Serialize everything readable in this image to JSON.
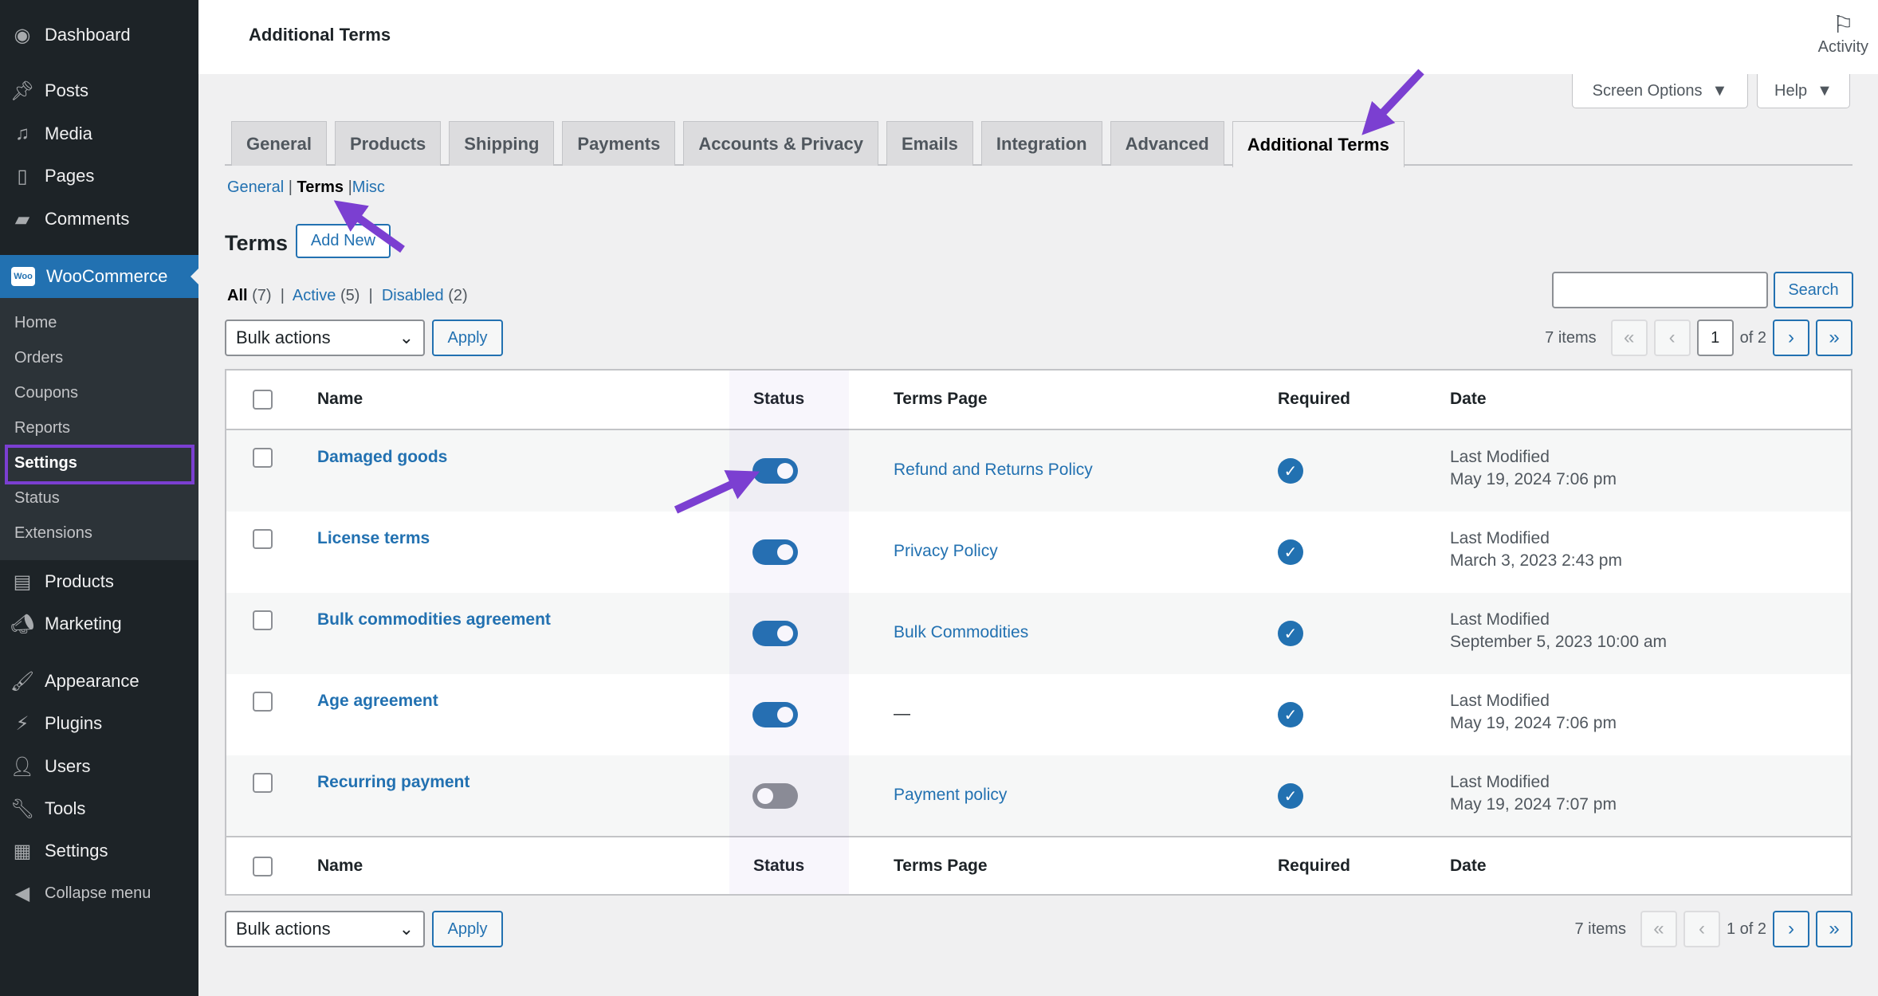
{
  "sidebar": {
    "dashboard": "Dashboard",
    "posts": "Posts",
    "media": "Media",
    "pages": "Pages",
    "comments": "Comments",
    "woocommerce": "WooCommerce",
    "woo_logo": "Woo",
    "sub": [
      "Home",
      "Orders",
      "Coupons",
      "Reports",
      "Settings",
      "Status",
      "Extensions"
    ],
    "products": "Products",
    "marketing": "Marketing",
    "appearance": "Appearance",
    "plugins": "Plugins",
    "users": "Users",
    "tools": "Tools",
    "settings": "Settings",
    "collapse": "Collapse menu"
  },
  "header": {
    "title": "Additional Terms",
    "activity": "Activity",
    "screen_options": "Screen Options",
    "help": "Help"
  },
  "tabs": [
    "General",
    "Products",
    "Shipping",
    "Payments",
    "Accounts & Privacy",
    "Emails",
    "Integration",
    "Advanced",
    "Additional Terms"
  ],
  "subtabs": {
    "general": "General",
    "terms": "Terms",
    "misc": "Misc"
  },
  "page": {
    "heading": "Terms",
    "add_new": "Add New"
  },
  "filters": {
    "all": "All",
    "all_count": "(7)",
    "active": "Active",
    "active_count": "(5)",
    "disabled": "Disabled",
    "disabled_count": "(2)"
  },
  "search": {
    "value": "",
    "button": "Search"
  },
  "bulk": {
    "selected": "Bulk actions",
    "apply": "Apply"
  },
  "pagination": {
    "items": "7 items",
    "first": "«",
    "prev": "‹",
    "current": "1",
    "of": "of 2",
    "of_bottom": "1 of 2",
    "next": "›",
    "last": "»"
  },
  "table": {
    "headers": {
      "name": "Name",
      "status": "Status",
      "terms_page": "Terms Page",
      "required": "Required",
      "date": "Date"
    },
    "rows": [
      {
        "name": "Damaged goods",
        "active": true,
        "terms_page": "Refund and Returns Policy",
        "required": true,
        "date_label": "Last Modified",
        "date": "May 19, 2024 7:06 pm"
      },
      {
        "name": "License terms",
        "active": true,
        "terms_page": "Privacy Policy",
        "required": true,
        "date_label": "Last Modified",
        "date": "March 3, 2023 2:43 pm"
      },
      {
        "name": "Bulk commodities agreement",
        "active": true,
        "terms_page": "Bulk Commodities",
        "required": true,
        "date_label": "Last Modified",
        "date": "September 5, 2023 10:00 am"
      },
      {
        "name": "Age agreement",
        "active": true,
        "terms_page": "—",
        "required": true,
        "date_label": "Last Modified",
        "date": "May 19, 2024 7:06 pm"
      },
      {
        "name": "Recurring payment",
        "active": false,
        "terms_page": "Payment policy",
        "required": true,
        "date_label": "Last Modified",
        "date": "May 19, 2024 7:07 pm"
      }
    ]
  },
  "colors": {
    "accent": "#2271b1",
    "sidebar": "#1d2327",
    "annotation": "#7b3fd1"
  }
}
